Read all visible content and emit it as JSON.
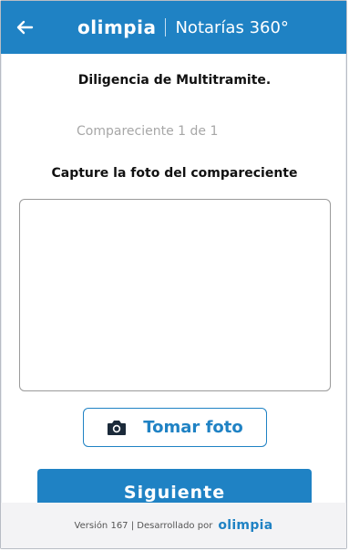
{
  "header": {
    "brand_wordmark": "OLIMPIA",
    "brand_subtitle": "Notarías 360°",
    "back_icon": "arrow-left-icon"
  },
  "content": {
    "title": "Diligencia de Multitramite.",
    "compareciente_label": "Compareciente 1 de 1",
    "instruction": "Capture la foto del compareciente"
  },
  "actions": {
    "take_photo_label": "Tomar foto",
    "take_photo_icon": "camera-icon",
    "next_label": "Siguiente"
  },
  "footer": {
    "version_text": "Versión 167 | Desarrollado por",
    "logo_text": "OLIMPIA"
  },
  "colors": {
    "primary": "#1f82c4",
    "text": "#111111",
    "muted": "#a7a7a7",
    "footer_bg": "#f3f3f5"
  }
}
